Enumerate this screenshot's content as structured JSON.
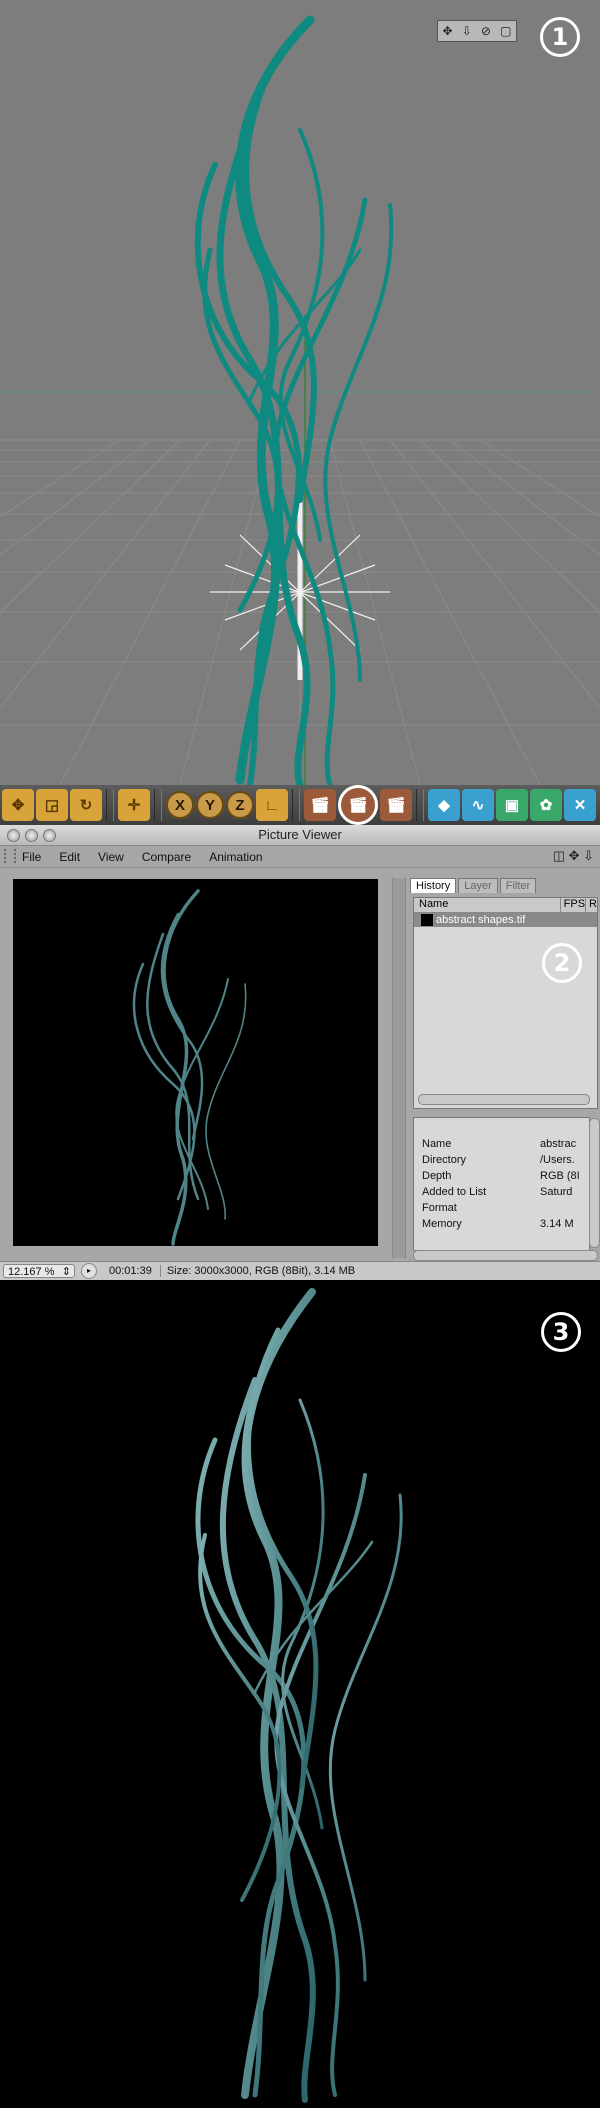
{
  "badges": {
    "one": "1",
    "two": "2",
    "three": "3"
  },
  "viewport_nav": {
    "move": "✥",
    "down": "⇩",
    "rotate": "⊘",
    "frame": "▢"
  },
  "toolbar": {
    "x_axis": "X",
    "y_axis": "Y",
    "z_axis": "Z"
  },
  "picture_viewer": {
    "title": "Picture Viewer",
    "menu": [
      "File",
      "Edit",
      "View",
      "Compare",
      "Animation"
    ],
    "tabs": [
      "History",
      "Layer",
      "Filter"
    ],
    "history_columns": [
      "Name",
      "FPS",
      "R"
    ],
    "history_item": "abstract shapes.tif",
    "info": [
      {
        "key": "Name",
        "value": "abstrac"
      },
      {
        "key": "Directory",
        "value": "/Users."
      },
      {
        "key": "Depth",
        "value": "RGB (8I"
      },
      {
        "key": "Added to List",
        "value": "Saturd"
      },
      {
        "key": "Format",
        "value": ""
      },
      {
        "key": "Memory",
        "value": "3.14 M"
      }
    ],
    "status": {
      "zoom": "12.167 %",
      "zoom_arrow": "⇕",
      "time": "00:01:39",
      "size": "Size: 3000x3000, RGB (8Bit), 3.14 MB"
    }
  },
  "colors": {
    "viewport_bg": "#7d7d7d",
    "strand_teal": "#0f8a80",
    "render_strand": "#5f9ca0"
  }
}
